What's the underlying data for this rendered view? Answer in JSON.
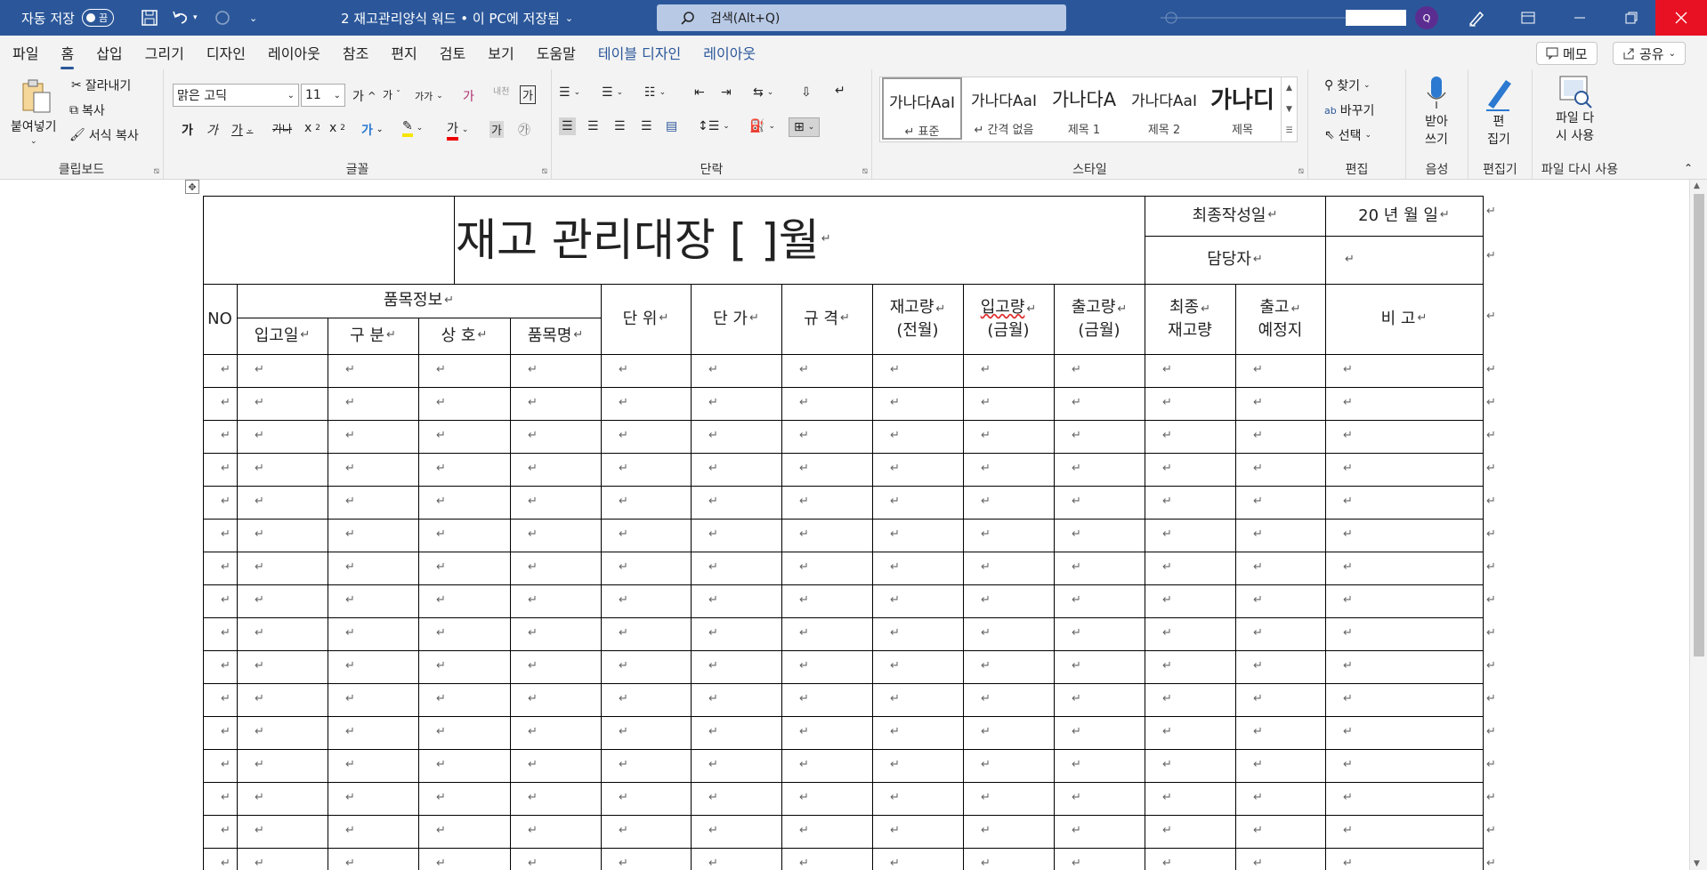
{
  "titlebar": {
    "autosave": "자동 저장",
    "toggle": "끔",
    "doc_title": "2 재고관리양식 워드 • 이 PC에 저장됨",
    "search_placeholder": "검색(Alt+Q)"
  },
  "menu": [
    "파일",
    "홈",
    "삽입",
    "그리기",
    "디자인",
    "레이아웃",
    "참조",
    "편지",
    "검토",
    "보기",
    "도움말",
    "테이블 디자인",
    "레이아웃"
  ],
  "right_buttons": {
    "memo": "메모",
    "share": "공유"
  },
  "ribbon": {
    "clipboard": {
      "paste": "붙여넣기",
      "cut": "잘라내기",
      "copy": "복사",
      "format_copy": "서식 복사",
      "label": "클립보드"
    },
    "font": {
      "name": "맑은 고딕",
      "size": "11",
      "label": "글꼴",
      "grow": "가",
      "shrink": "가",
      "case": "가가",
      "clear": "가",
      "bold": "가",
      "italic": "가",
      "underline": "가",
      "strike": "가나",
      "sub": "x",
      "sup": "x",
      "color_a": "가",
      "shade": "가",
      "circle": "㉮",
      "phonetic": "내천"
    },
    "paragraph": {
      "label": "단락"
    },
    "styles": {
      "label": "스타일",
      "items": [
        {
          "sample": "가나다AaI",
          "name": "↵ 표준"
        },
        {
          "sample": "가나다AaI",
          "name": "↵ 간격 없음"
        },
        {
          "sample": "가나다A",
          "name": "제목 1"
        },
        {
          "sample": "가나다AaI",
          "name": "제목 2"
        },
        {
          "sample": "가나디",
          "name": "제목"
        }
      ]
    },
    "editing": {
      "find": "찾기",
      "replace": "바꾸기",
      "select": "선택",
      "label": "편집"
    },
    "voice": {
      "dictate_1": "받아",
      "dictate_2": "쓰기",
      "label": "음성"
    },
    "editor": {
      "name_1": "편",
      "name_2": "집기",
      "label": "편집기"
    },
    "reuse": {
      "name_1": "파일 다",
      "name_2": "시 사용",
      "label": "파일 다시 사용"
    }
  },
  "document": {
    "title": "재고 관리대장 [ ]월",
    "last_date_label": "최종작성일",
    "date_value": "20 년 월 일",
    "manager_label": "담당자",
    "headers": {
      "no": "NO",
      "item_info": "품목정보",
      "in_date": "입고일",
      "category": "구 분",
      "brand": "상 호",
      "item_name": "품목명",
      "unit": "단 위",
      "price": "단 가",
      "spec": "규 격",
      "stock_prev_1": "재고량",
      "stock_prev_2": "(전월)",
      "in_qty_1": "입고량",
      "in_qty_2": "(금월)",
      "out_qty_1": "출고량",
      "out_qty_2": "(금월)",
      "final_1": "최종",
      "final_2": "재고량",
      "ship_1": "출고",
      "ship_2": "예정지",
      "remark": "비 고"
    },
    "para_mark": "↵"
  }
}
